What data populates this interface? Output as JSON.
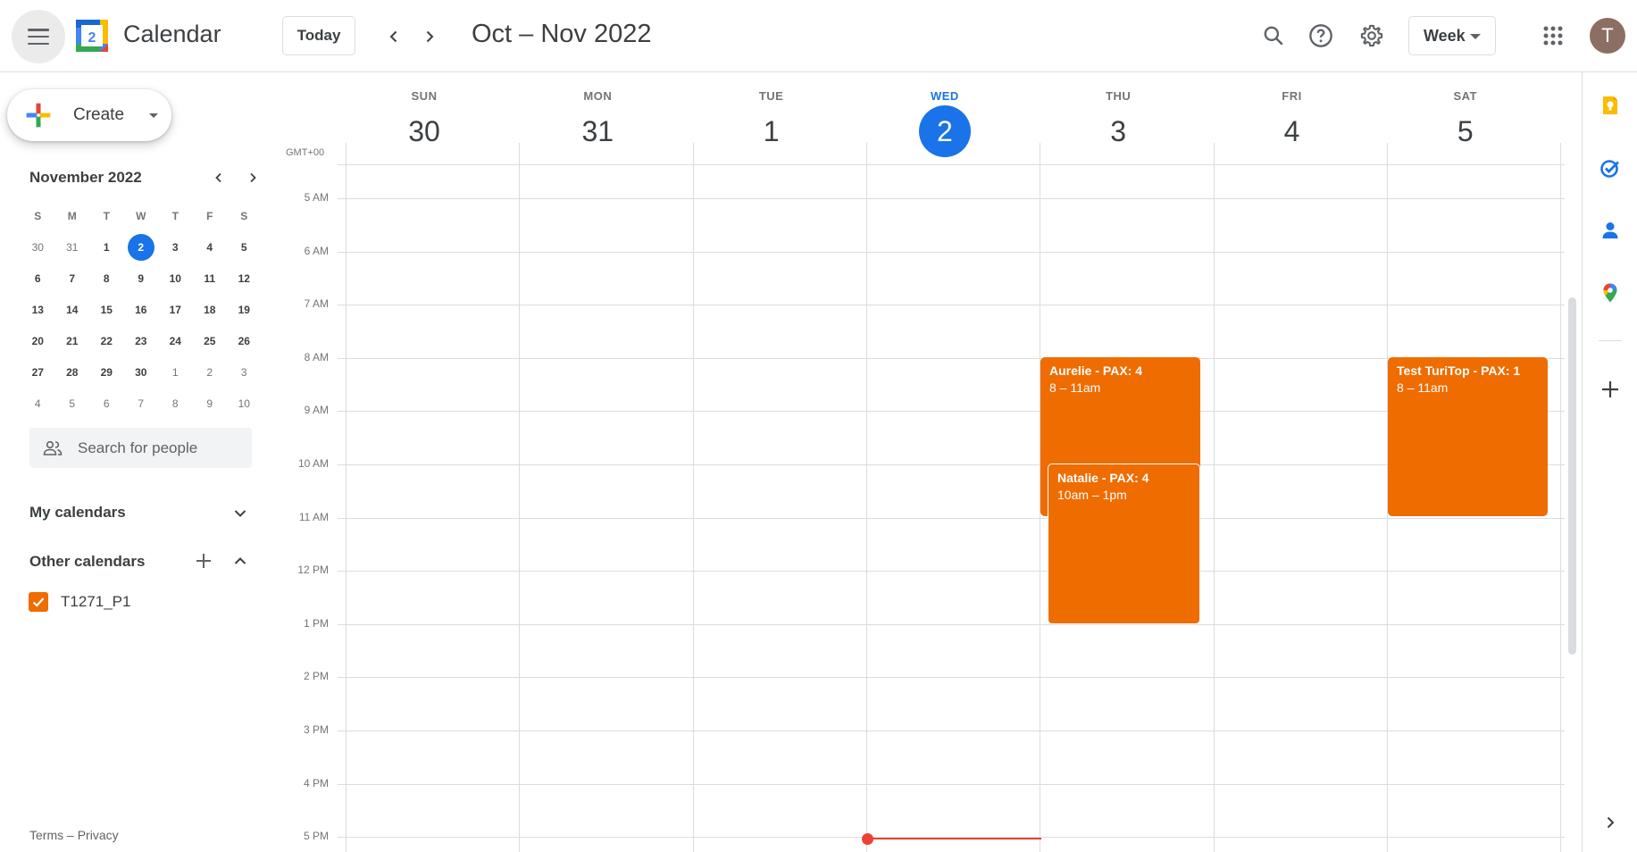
{
  "header": {
    "app_title": "Calendar",
    "logo_day": "2",
    "today_label": "Today",
    "date_range": "Oct – Nov 2022",
    "view_label": "Week",
    "avatar_initial": "T"
  },
  "sidebar": {
    "create_label": "Create",
    "mini_calendar": {
      "title": "November 2022",
      "weekday_heads": [
        "S",
        "M",
        "T",
        "W",
        "T",
        "F",
        "S"
      ],
      "weeks": [
        [
          "30",
          "31",
          "1",
          "2",
          "3",
          "4",
          "5"
        ],
        [
          "6",
          "7",
          "8",
          "9",
          "10",
          "11",
          "12"
        ],
        [
          "13",
          "14",
          "15",
          "16",
          "17",
          "18",
          "19"
        ],
        [
          "20",
          "21",
          "22",
          "23",
          "24",
          "25",
          "26"
        ],
        [
          "27",
          "28",
          "29",
          "30",
          "1",
          "2",
          "3"
        ],
        [
          "4",
          "5",
          "6",
          "7",
          "8",
          "9",
          "10"
        ]
      ]
    },
    "search_people_placeholder": "Search for people",
    "my_calendars_label": "My calendars",
    "other_calendars_label": "Other calendars",
    "other_calendar_items": [
      {
        "name": "T1271_P1",
        "color": "#ef6c00",
        "checked": true
      }
    ],
    "footer_terms": "Terms",
    "footer_sep": " – ",
    "footer_privacy": "Privacy"
  },
  "week": {
    "timezone": "GMT+00",
    "days": [
      {
        "name": "SUN",
        "num": "30"
      },
      {
        "name": "MON",
        "num": "31"
      },
      {
        "name": "TUE",
        "num": "1"
      },
      {
        "name": "WED",
        "num": "2",
        "today": true
      },
      {
        "name": "THU",
        "num": "3"
      },
      {
        "name": "FRI",
        "num": "4"
      },
      {
        "name": "SAT",
        "num": "5"
      }
    ],
    "hours": [
      "5 AM",
      "6 AM",
      "7 AM",
      "8 AM",
      "9 AM",
      "10 AM",
      "11 AM",
      "12 PM",
      "1 PM",
      "2 PM",
      "3 PM",
      "4 PM",
      "5 PM"
    ],
    "events": [
      {
        "title": "Aurelie - PAX: 4",
        "time": "8 – 11am"
      },
      {
        "title": "Natalie - PAX: 4",
        "time": "10am – 1pm"
      },
      {
        "title": "Test TuriTop - PAX: 1",
        "time": "8 – 11am"
      }
    ]
  },
  "colors": {
    "accent": "#1a73e8",
    "event": "#ef6c00",
    "now_line": "#ea4335"
  }
}
